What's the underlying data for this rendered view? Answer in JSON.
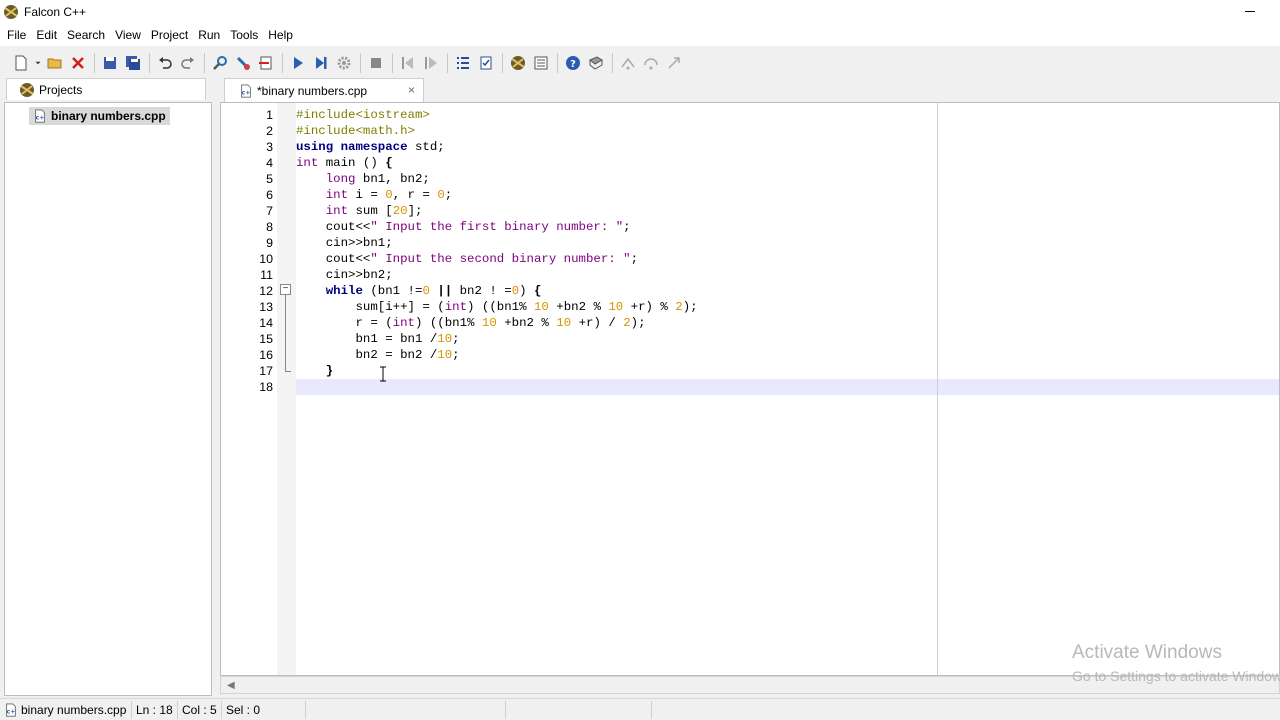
{
  "window": {
    "title": "Falcon C++"
  },
  "menu": [
    "File",
    "Edit",
    "Search",
    "View",
    "Project",
    "Run",
    "Tools",
    "Help"
  ],
  "projects_panel": {
    "tab_label": "Projects",
    "items": [
      {
        "label": "binary numbers.cpp"
      }
    ]
  },
  "editor_tab": {
    "label": "*binary numbers.cpp",
    "close": "×"
  },
  "code": {
    "line_numbers": [
      "1",
      "2",
      "3",
      "4",
      "5",
      "6",
      "7",
      "8",
      "9",
      "10",
      "11",
      "12",
      "13",
      "14",
      "15",
      "16",
      "17",
      "18"
    ],
    "current_line": 18
  },
  "status": {
    "file": "binary numbers.cpp",
    "ln": "Ln : 18",
    "col": "Col : 5",
    "sel": "Sel : 0"
  },
  "watermark": {
    "line1": "Activate Windows",
    "line2": "Go to Settings to activate Windows."
  },
  "colors": {
    "keyword": "#00007f",
    "number": "#d69500",
    "current_line": "#e8e8ff"
  }
}
